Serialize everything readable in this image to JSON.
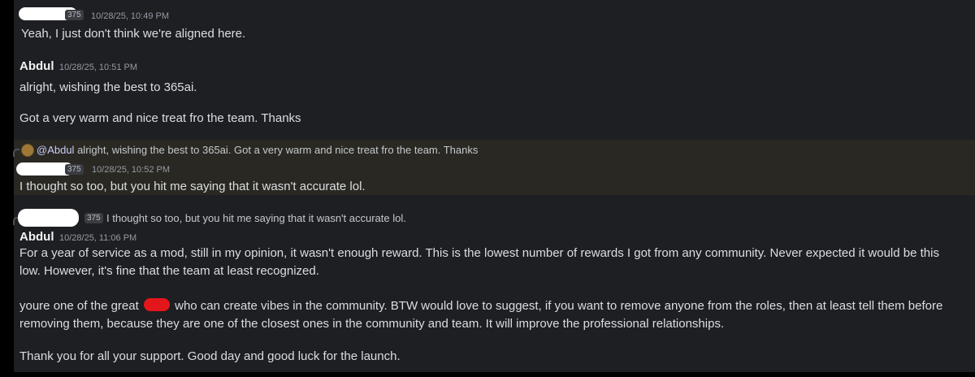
{
  "messages": [
    {
      "author_badge": "375",
      "timestamp": "10/28/25, 10:49 PM",
      "lines": [
        "Yeah, I just don't think we're aligned here."
      ]
    },
    {
      "author": "Abdul",
      "timestamp": "10/28/25, 10:51 PM",
      "lines": [
        "alright, wishing the best to 365ai.",
        "Got a very warm and nice treat fro the team. Thanks"
      ]
    },
    {
      "reply_mention": "@Abdul",
      "reply_text": "alright, wishing the best to 365ai.   Got a very warm and nice treat fro the team. Thanks",
      "author_badge": "375",
      "timestamp": "10/28/25, 10:52 PM",
      "lines": [
        "I thought so too, but you hit me saying that it wasn't accurate lol."
      ]
    },
    {
      "reply_badge": "375",
      "reply_text": "I thought so too, but you hit me saying that it wasn't accurate lol.",
      "author": "Abdul",
      "timestamp": "10/28/25, 11:06 PM",
      "paragraph1": "For a year of service as a mod, still in my opinion, it wasn't enough reward. This is the lowest number of rewards I got from any community. Never expected it would be this low. However, it's fine that the team at least recognized.",
      "paragraph2_before": "youre one of the great",
      "paragraph2_after": "who can create vibes in the community. BTW would love to suggest, if you want to remove anyone from the roles, then at least tell them before removing them, because they are one of the closest ones in the community and team. It will improve the professional relationships.",
      "paragraph3": "Thank you for all your support. Good day and good luck for the launch."
    }
  ],
  "colors": {
    "background": "#1e1f22",
    "highlight": "#2a2822",
    "mention": "#c9cdfb",
    "redaction": "#ffffff",
    "redaction_red": "#e3161b"
  }
}
